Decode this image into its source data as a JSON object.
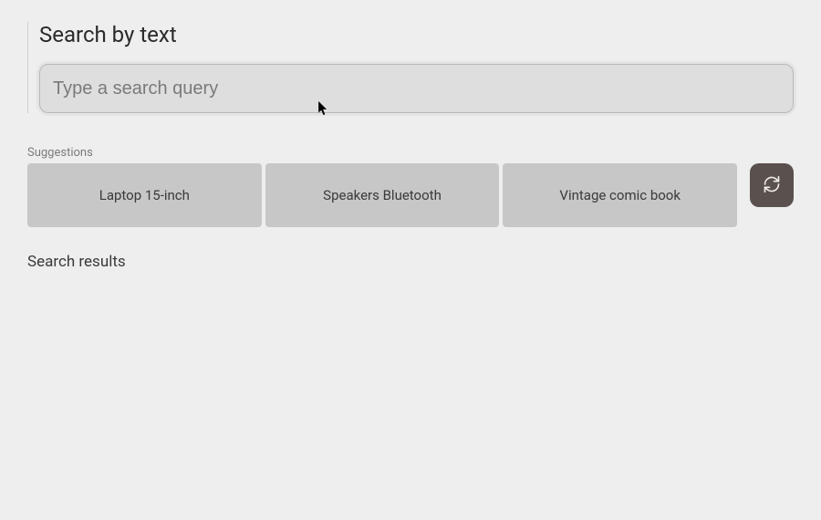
{
  "header": {
    "title": "Search by text"
  },
  "search": {
    "placeholder": "Type a search query",
    "value": ""
  },
  "suggestions": {
    "label": "Suggestions",
    "items": [
      {
        "label": "Laptop 15-inch"
      },
      {
        "label": "Speakers Bluetooth"
      },
      {
        "label": "Vintage comic book"
      }
    ],
    "refresh_icon": "refresh"
  },
  "results": {
    "title": "Search results"
  },
  "colors": {
    "page_bg": "#eeeeee",
    "input_bg": "#dedede",
    "chip_bg": "#c7c7c7",
    "refresh_bg": "#5a504d"
  }
}
